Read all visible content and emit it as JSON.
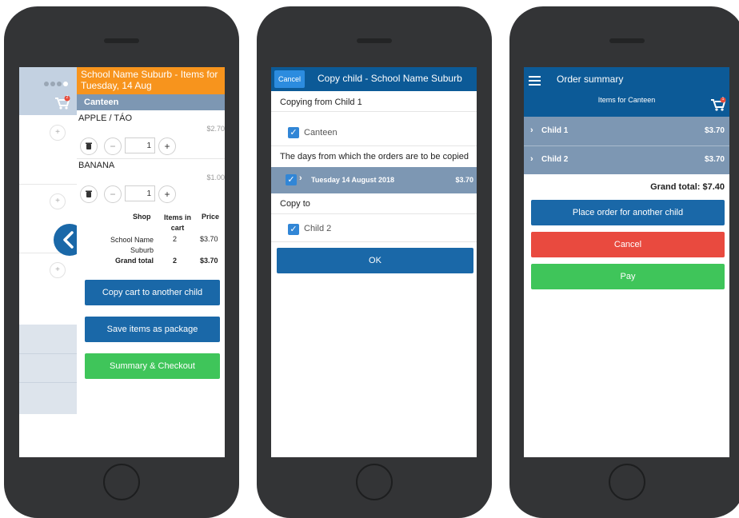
{
  "phone1": {
    "title": "School Name Suburb - Items for Tuesday, 14 Aug",
    "section": "Canteen",
    "items": [
      {
        "name": "APPLE / TÁO",
        "price": "$2.70",
        "qty": "1"
      },
      {
        "name": "BANANA",
        "price": "$1.00",
        "qty": "1"
      }
    ],
    "table": {
      "headers": [
        "Shop",
        "Items in cart",
        "Price"
      ],
      "row": {
        "shop": "School Name Suburb",
        "items": "2",
        "price": "$3.70"
      },
      "total": {
        "label": "Grand total",
        "items": "2",
        "price": "$3.70"
      }
    },
    "buttons": {
      "copy": "Copy cart to another child",
      "save": "Save items as package",
      "checkout": "Summary & Checkout"
    },
    "cart_badge": "2",
    "icons": {
      "cart": "cart-icon",
      "back": "chevron-left-icon",
      "trash": "trash-icon",
      "plus": "plus-icon",
      "minus": "minus-icon"
    }
  },
  "phone2": {
    "cancel": "Cancel",
    "title": "Copy child - School Name Suburb",
    "copying_from": "Copying from Child 1",
    "canteen": "Canteen",
    "days_label": "The days from which the orders are to be copied",
    "day": {
      "label": "Tuesday 14 August 2018",
      "price": "$3.70"
    },
    "copy_to": "Copy to",
    "child": "Child 2",
    "ok": "OK",
    "icons": {
      "check": "check-icon",
      "chevron": "chevron-right-icon"
    }
  },
  "phone3": {
    "title": "Order summary",
    "subtitle": "Items for Canteen",
    "cart_badge": "1",
    "children": [
      {
        "name": "Child 1",
        "amount": "$3.70"
      },
      {
        "name": "Child 2",
        "amount": "$3.70"
      }
    ],
    "grand_total": "Grand total: $7.40",
    "buttons": {
      "place_order": "Place order for another child",
      "cancel": "Cancel",
      "pay": "Pay"
    },
    "icons": {
      "menu": "hamburger-menu-icon",
      "cart": "cart-icon",
      "chevron": "chevron-right-icon"
    }
  },
  "colors": {
    "orange": "#f7941d",
    "steel": "#7d97b3",
    "navy": "#0c5a97",
    "blue_button": "#1a68a8",
    "green": "#3fc55a",
    "red": "#e94a3f",
    "phone_body": "#333436"
  }
}
